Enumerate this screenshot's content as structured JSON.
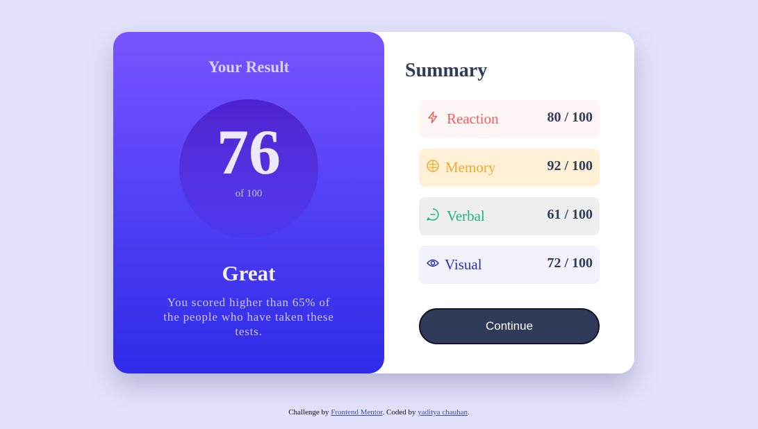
{
  "result": {
    "title": "Your Result",
    "score": "76",
    "score_of": "of 100",
    "rating": "Great",
    "description": "You scored higher than 65% of the people who have taken these tests."
  },
  "summary": {
    "title": "Summary",
    "items": [
      {
        "label": "Reaction",
        "score": "80",
        "total": "/ 100",
        "icon": "lightning-icon",
        "color": "#f55d5d",
        "bg": "#fff6f5"
      },
      {
        "label": "Memory",
        "score": "92",
        "total": "/ 100",
        "icon": "brain-icon",
        "color": "#f6a92d",
        "bg": "#fff0d6"
      },
      {
        "label": "Verbal",
        "score": "61",
        "total": "/ 100",
        "icon": "chat-icon",
        "color": "#19b780",
        "bg": "#efefef"
      },
      {
        "label": "Visual",
        "score": "72",
        "total": "/ 100",
        "icon": "eye-icon",
        "color": "#2830b8",
        "bg": "#f2f2fd"
      }
    ],
    "continue_label": "Continue"
  },
  "footer": {
    "prefix": "Challenge by ",
    "link1": "Frontend Mentor",
    "middle": ". Coded by ",
    "link2": "yaditya chauhan",
    "suffix": "."
  }
}
